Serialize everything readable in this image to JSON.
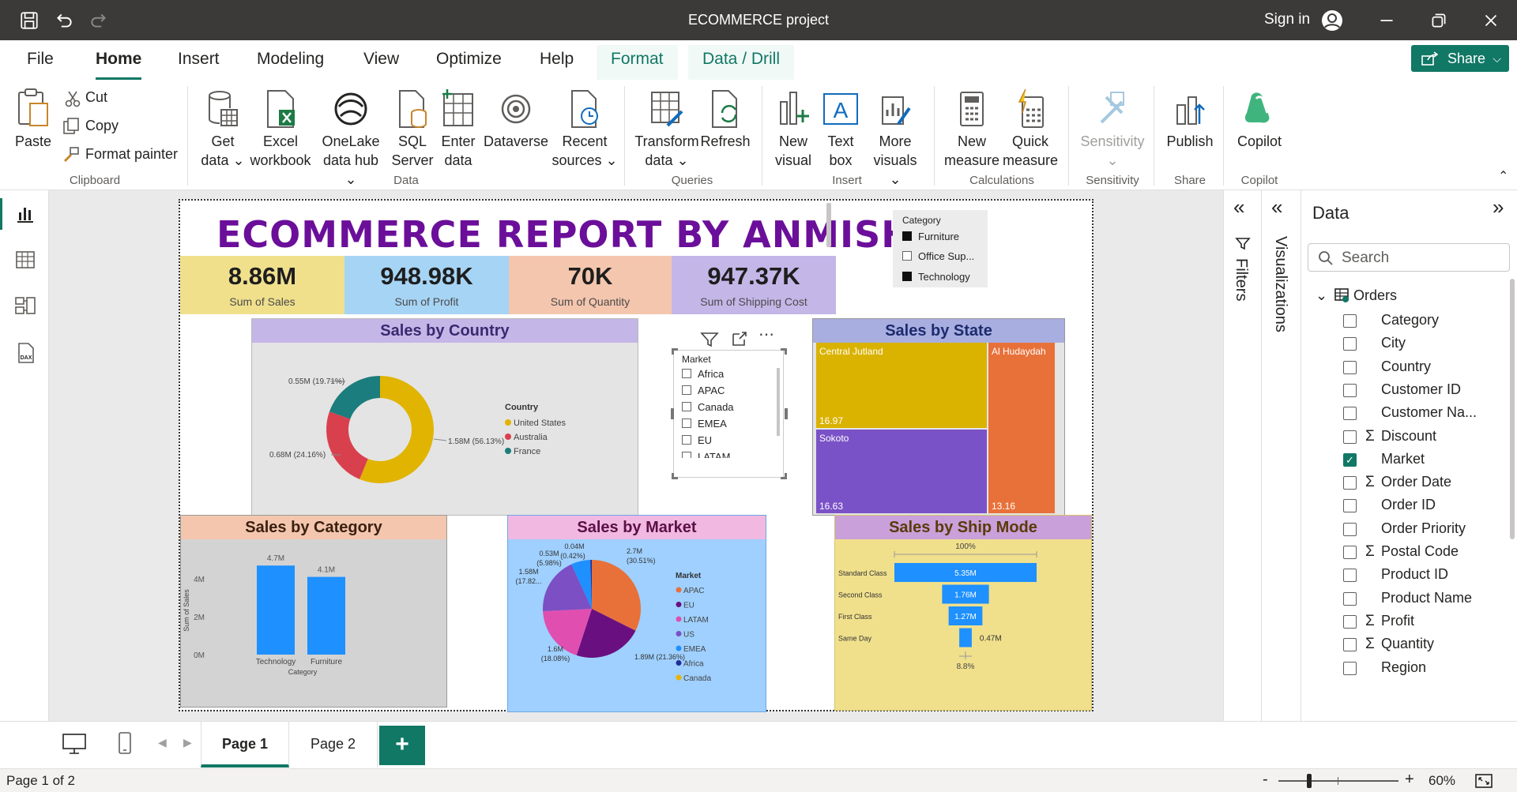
{
  "window": {
    "title": "ECOMMERCE project",
    "sign_in": "Sign in"
  },
  "menu": {
    "tabs": [
      "File",
      "Home",
      "Insert",
      "Modeling",
      "View",
      "Optimize",
      "Help"
    ],
    "context_tabs": [
      "Format",
      "Data / Drill"
    ],
    "share": "Share"
  },
  "ribbon": {
    "clipboard": {
      "paste": "Paste",
      "cut": "Cut",
      "copy": "Copy",
      "format_painter": "Format painter",
      "group": "Clipboard"
    },
    "data": {
      "get_data": [
        "Get",
        "data"
      ],
      "excel": [
        "Excel",
        "workbook"
      ],
      "onelake": [
        "OneLake",
        "data hub"
      ],
      "sql": [
        "SQL",
        "Server"
      ],
      "enter": [
        "Enter",
        "data"
      ],
      "dataverse": "Dataverse",
      "recent": [
        "Recent",
        "sources"
      ],
      "group": "Data"
    },
    "queries": {
      "transform": [
        "Transform",
        "data"
      ],
      "refresh": "Refresh",
      "group": "Queries"
    },
    "insert": {
      "new_visual": [
        "New",
        "visual"
      ],
      "text_box": [
        "Text",
        "box"
      ],
      "more_visuals": [
        "More",
        "visuals"
      ],
      "group": "Insert"
    },
    "calculations": {
      "new_measure": [
        "New",
        "measure"
      ],
      "quick_measure": [
        "Quick",
        "measure"
      ],
      "group": "Calculations"
    },
    "sensitivity": {
      "label": "Sensitivity",
      "group": "Sensitivity"
    },
    "share": {
      "publish": "Publish",
      "group": "Share"
    },
    "copilot": {
      "label": "Copilot",
      "group": "Copilot"
    }
  },
  "report": {
    "title": "ECOMMERCE  REPORT BY ANMISHA",
    "kpis": [
      {
        "value": "8.86M",
        "label": "Sum of Sales",
        "color": "#f0e08c"
      },
      {
        "value": "948.98K",
        "label": "Sum of Profit",
        "color": "#a6d4f5"
      },
      {
        "value": "70K",
        "label": "Sum of Quantity",
        "color": "#f4c6ae"
      },
      {
        "value": "947.37K",
        "label": "Sum of Shipping Cost",
        "color": "#c5b6e8"
      }
    ],
    "category_slicer": {
      "title": "Category",
      "items": [
        {
          "label": "Furniture",
          "checked": true
        },
        {
          "label": "Office Sup...",
          "checked": false
        },
        {
          "label": "Technology",
          "checked": true
        }
      ]
    },
    "market_slicer": {
      "title": "Market",
      "items": [
        "Africa",
        "APAC",
        "Canada",
        "EMEA",
        "EU",
        "LATAM"
      ]
    },
    "sales_by_country": {
      "title": "Sales by Country",
      "legend_title": "Country",
      "labels": [
        "0.55M (19.71%)",
        "0.68M (24.16%)",
        "1.58M (56.13%)"
      ]
    },
    "sales_by_state": {
      "title": "Sales by State",
      "labels": [
        "Central Jutland",
        "Al Hudaydah",
        "Sokoto"
      ],
      "values": [
        "16.97",
        "13.16",
        "16.63"
      ]
    },
    "sales_by_category": {
      "title": "Sales by Category",
      "ylabel": "Sum of Sales",
      "xlabel": "Category",
      "ticks": [
        "4M",
        "2M",
        "0M"
      ],
      "bar_labels": [
        "4.7M",
        "4.1M"
      ]
    },
    "sales_by_market": {
      "title": "Sales by Market",
      "legend_title": "Market",
      "labels": {
        "apac": [
          "2.7M",
          "(30.51%)"
        ],
        "eu": [
          "1.89M (21.36%)"
        ],
        "latam": [
          "1.6M",
          "(18.08%)"
        ],
        "us": [
          "1.58M",
          "(17.82..."
        ],
        "emea": [
          "0.53M",
          "(5.98%)"
        ],
        "africa": [
          "0.04M",
          "(0.42%)"
        ]
      }
    },
    "sales_by_ship_mode": {
      "title": "Sales by Ship Mode",
      "top_pct": "100%",
      "bottom_pct": "8.8%",
      "value_labels": [
        "5.35M",
        "1.76M",
        "1.27M",
        "0.47M"
      ]
    }
  },
  "chart_data": [
    {
      "type": "pie",
      "title": "Sales by Country",
      "categories": [
        "United States",
        "Australia",
        "France"
      ],
      "values": [
        1.58,
        0.68,
        0.55
      ],
      "percent": [
        56.13,
        24.16,
        19.71
      ],
      "unit": "M",
      "colors": [
        "#e0b400",
        "#d9404e",
        "#1b7d7d"
      ]
    },
    {
      "type": "bar",
      "title": "Sales by Category",
      "categories": [
        "Technology",
        "Furniture"
      ],
      "values": [
        4.7,
        4.1
      ],
      "unit": "M",
      "ylabel": "Sum of Sales",
      "xlabel": "Category",
      "ylim": [
        0,
        5
      ]
    },
    {
      "type": "pie",
      "title": "Sales by Market",
      "categories": [
        "APAC",
        "EU",
        "LATAM",
        "US",
        "EMEA",
        "Africa",
        "Canada"
      ],
      "values": [
        2.7,
        1.89,
        1.6,
        1.58,
        0.53,
        0.04,
        0
      ],
      "percent": [
        30.51,
        21.36,
        18.08,
        17.82,
        5.98,
        0.42,
        0
      ],
      "unit": "M",
      "colors": [
        "#e8713a",
        "#6a0f80",
        "#e04fb0",
        "#7c4fc4",
        "#1e90ff",
        "#1f2e99",
        "#e8b400"
      ]
    },
    {
      "type": "bar",
      "title": "Sales by Ship Mode",
      "categories": [
        "Standard Class",
        "Second Class",
        "First Class",
        "Same Day"
      ],
      "values": [
        5.35,
        1.76,
        1.27,
        0.47
      ],
      "unit": "M"
    },
    {
      "type": "heatmap",
      "title": "Sales by State",
      "categories": [
        "Central Jutland",
        "Al Hudaydah",
        "Sokoto"
      ],
      "values": [
        16.97,
        13.16,
        16.63
      ]
    }
  ],
  "panes": {
    "filters": "Filters",
    "visualizations": "Visualizations",
    "data_title": "Data",
    "search_placeholder": "Search",
    "table": "Orders",
    "fields": [
      {
        "name": "Category",
        "sigma": false,
        "checked": false
      },
      {
        "name": "City",
        "sigma": false,
        "checked": false
      },
      {
        "name": "Country",
        "sigma": false,
        "checked": false
      },
      {
        "name": "Customer ID",
        "sigma": false,
        "checked": false
      },
      {
        "name": "Customer Na...",
        "sigma": false,
        "checked": false
      },
      {
        "name": "Discount",
        "sigma": true,
        "checked": false
      },
      {
        "name": "Market",
        "sigma": false,
        "checked": true
      },
      {
        "name": "Order Date",
        "sigma": true,
        "checked": false
      },
      {
        "name": "Order ID",
        "sigma": false,
        "checked": false
      },
      {
        "name": "Order Priority",
        "sigma": false,
        "checked": false
      },
      {
        "name": "Postal Code",
        "sigma": true,
        "checked": false
      },
      {
        "name": "Product ID",
        "sigma": false,
        "checked": false
      },
      {
        "name": "Product Name",
        "sigma": false,
        "checked": false
      },
      {
        "name": "Profit",
        "sigma": true,
        "checked": false
      },
      {
        "name": "Quantity",
        "sigma": true,
        "checked": false
      },
      {
        "name": "Region",
        "sigma": false,
        "checked": false
      }
    ]
  },
  "pages": {
    "tabs": [
      "Page 1",
      "Page 2"
    ],
    "active": "Page 1"
  },
  "status": {
    "page_info": "Page 1 of 2",
    "zoom": "60%"
  }
}
